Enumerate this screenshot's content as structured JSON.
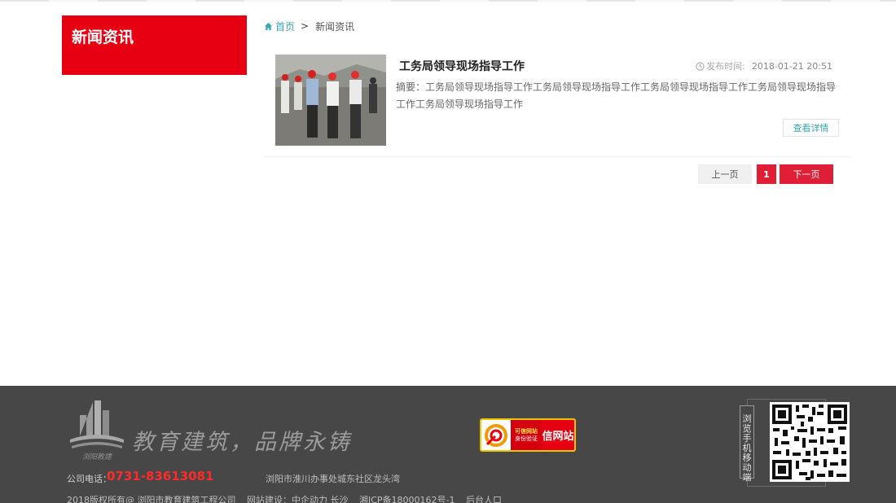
{
  "sidebar": {
    "title": "新闻资讯"
  },
  "breadcrumb": {
    "home": "首页",
    "separator": ">",
    "current": "新闻资讯"
  },
  "news": [
    {
      "title": "工务局领导现场指导工作",
      "date_label": "发布时间:",
      "date": "2018-01-21 20:51",
      "summary": "摘要：工务局领导现场指导工作工务局领导现场指导工作工务局领导现场指导工作工务局领导现场指导工作工务局领导现场指导工作",
      "detail_label": "查看详情"
    }
  ],
  "pagination": {
    "prev": "上一页",
    "current": "1",
    "next": "下一页"
  },
  "footer": {
    "logo_text": "浏阳教建",
    "slogan": "教育建筑，品牌永铸",
    "phone_label": "公司电话：",
    "phone": "0731-83613081",
    "address": "浏阳市淮川办事处城东社区龙头湾",
    "copyright": "2018版权所有@ 浏阳市教育建筑工程公司",
    "site_build": "网站建设：中企动力 长沙",
    "icp": "湘ICP备18000162号-1",
    "admin": "后台人口",
    "badge": {
      "top": "可信网站",
      "bottom": "身份验证",
      "name": "信网站"
    },
    "mobile_label": "浏览手机移动端"
  },
  "colors": {
    "accent": "#e60012",
    "link": "#39a5b4",
    "footer_bg": "#474747",
    "pager_red": "#e01e35"
  }
}
